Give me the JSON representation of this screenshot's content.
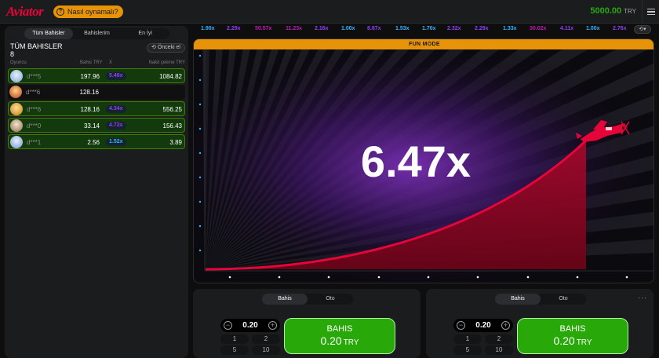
{
  "header": {
    "logo": "Aviator",
    "how_to_play": "Nasıl oynamalı?",
    "balance": "5000.00",
    "currency": "TRY",
    "menu_icon": "hamburger-icon"
  },
  "bets_panel": {
    "tabs": [
      "Tüm Bahisler",
      "Bahislerim",
      "En İyi"
    ],
    "active_tab": "Tüm Bahisler",
    "title": "TÜM BAHISLER",
    "count": "8",
    "previous_label": "Önceki el",
    "columns": {
      "player": "Oyuncu",
      "bet": "Bahis TRY",
      "x": "X",
      "cashout": "Nakit çekme TRY"
    },
    "rows": [
      {
        "user": "d***5",
        "bet": "197.96",
        "mult": "5.48x",
        "cashout": "1084.82",
        "won": true,
        "mult_color": "purple"
      },
      {
        "user": "d***6",
        "bet": "128.16",
        "mult": "",
        "cashout": "",
        "won": false,
        "mult_color": ""
      },
      {
        "user": "d***6",
        "bet": "128.16",
        "mult": "4.34x",
        "cashout": "556.25",
        "won": true,
        "mult_color": "purple"
      },
      {
        "user": "d***0",
        "bet": "33.14",
        "mult": "4.72x",
        "cashout": "156.43",
        "won": true,
        "mult_color": "purple"
      },
      {
        "user": "d***1",
        "bet": "2.56",
        "mult": "1.52x",
        "cashout": "3.89",
        "won": true,
        "mult_color": "blue"
      }
    ]
  },
  "history": [
    {
      "v": "1.90x",
      "c": "#34b4ff"
    },
    {
      "v": "2.29x",
      "c": "#913ef8"
    },
    {
      "v": "50.57x",
      "c": "#c017b4"
    },
    {
      "v": "11.23x",
      "c": "#c017b4"
    },
    {
      "v": "2.16x",
      "c": "#913ef8"
    },
    {
      "v": "1.00x",
      "c": "#34b4ff"
    },
    {
      "v": "8.87x",
      "c": "#913ef8"
    },
    {
      "v": "1.53x",
      "c": "#34b4ff"
    },
    {
      "v": "1.70x",
      "c": "#34b4ff"
    },
    {
      "v": "2.32x",
      "c": "#913ef8"
    },
    {
      "v": "2.29x",
      "c": "#913ef8"
    },
    {
      "v": "1.33x",
      "c": "#34b4ff"
    },
    {
      "v": "30.02x",
      "c": "#c017b4"
    },
    {
      "v": "4.11x",
      "c": "#913ef8"
    },
    {
      "v": "1.00x",
      "c": "#34b4ff"
    },
    {
      "v": "2.76x",
      "c": "#913ef8"
    }
  ],
  "game": {
    "mode_label": "FUN MODE",
    "multiplier": "6.47x",
    "plane_icon": "airplane-icon"
  },
  "bet_panels": [
    {
      "tabs": [
        "Bahis",
        "Oto"
      ],
      "active": "Bahis",
      "amount": "0.20",
      "quick": [
        "1",
        "2",
        "5",
        "10"
      ],
      "button_label": "BAHIS",
      "button_amount": "0.20",
      "button_currency": "TRY"
    },
    {
      "tabs": [
        "Bahis",
        "Oto"
      ],
      "active": "Bahis",
      "amount": "0.20",
      "quick": [
        "1",
        "2",
        "5",
        "10"
      ],
      "button_label": "BAHIS",
      "button_amount": "0.20",
      "button_currency": "TRY",
      "more": "···"
    }
  ],
  "colors": {
    "accent_red": "#e50539",
    "orange": "#e69308",
    "green": "#28a909",
    "blue": "#34b4ff",
    "purple": "#913ef8",
    "pink": "#c017b4"
  }
}
